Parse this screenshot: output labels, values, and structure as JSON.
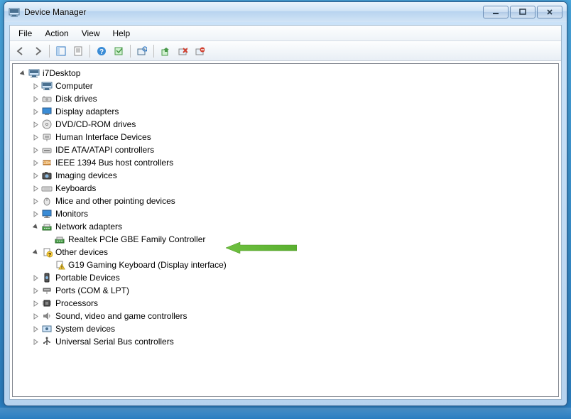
{
  "window": {
    "title": "Device Manager"
  },
  "menu": {
    "file": "File",
    "action": "Action",
    "view": "View",
    "help": "Help"
  },
  "root": {
    "label": "i7Desktop"
  },
  "categories": [
    {
      "label": "Computer",
      "icon": "computer"
    },
    {
      "label": "Disk drives",
      "icon": "disk"
    },
    {
      "label": "Display adapters",
      "icon": "display"
    },
    {
      "label": "DVD/CD-ROM drives",
      "icon": "dvd"
    },
    {
      "label": "Human Interface Devices",
      "icon": "hid"
    },
    {
      "label": "IDE ATA/ATAPI controllers",
      "icon": "ide"
    },
    {
      "label": "IEEE 1394 Bus host controllers",
      "icon": "1394"
    },
    {
      "label": "Imaging devices",
      "icon": "imaging"
    },
    {
      "label": "Keyboards",
      "icon": "keyboard"
    },
    {
      "label": "Mice and other pointing devices",
      "icon": "mouse"
    },
    {
      "label": "Monitors",
      "icon": "monitor"
    }
  ],
  "network": {
    "label": "Network adapters",
    "child": "Realtek PCIe GBE Family Controller"
  },
  "other": {
    "label": "Other devices",
    "child": "G19 Gaming Keyboard (Display interface)"
  },
  "categories2": [
    {
      "label": "Portable Devices",
      "icon": "portable"
    },
    {
      "label": "Ports (COM & LPT)",
      "icon": "ports"
    },
    {
      "label": "Processors",
      "icon": "cpu"
    },
    {
      "label": "Sound, video and game controllers",
      "icon": "sound"
    },
    {
      "label": "System devices",
      "icon": "system"
    },
    {
      "label": "Universal Serial Bus controllers",
      "icon": "usb"
    }
  ]
}
